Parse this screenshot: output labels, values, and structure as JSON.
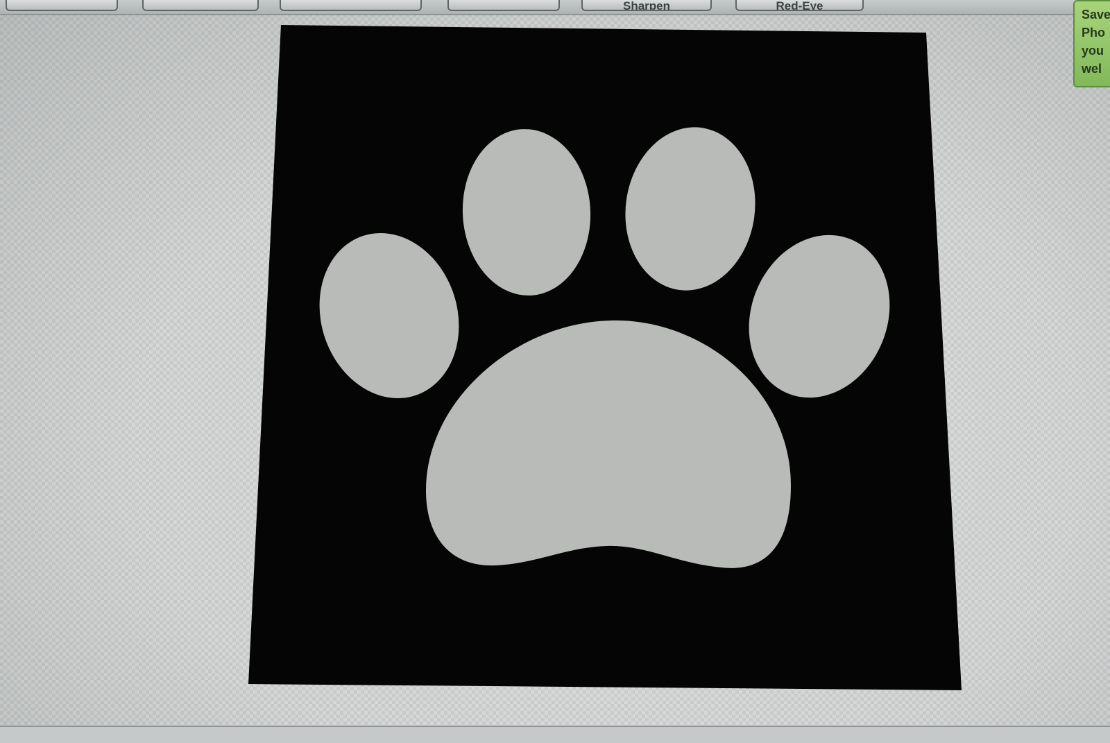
{
  "toolbar": {
    "buttons": [
      {
        "label": ""
      },
      {
        "label": ""
      },
      {
        "label": ""
      },
      {
        "label": ""
      },
      {
        "label": "Sharpen"
      },
      {
        "label": "Red-Eye"
      }
    ]
  },
  "tooltip": {
    "lines": [
      "Save",
      "Pho",
      "you",
      "wel"
    ]
  },
  "image": {
    "subject": "paw-print",
    "background_color": "#050505",
    "shape_color": "#b9bbb9"
  }
}
